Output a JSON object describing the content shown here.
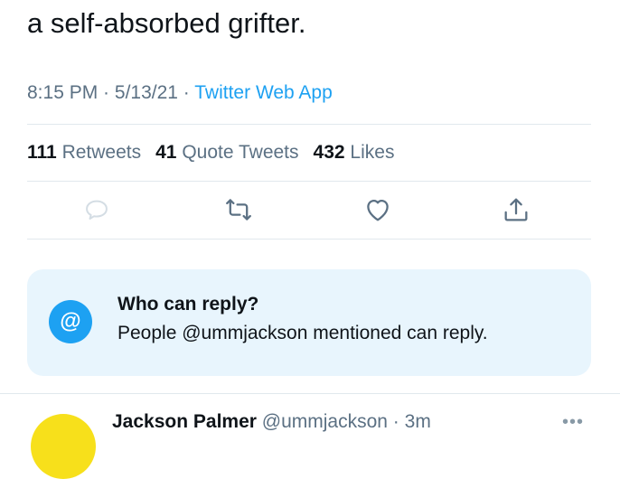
{
  "tweet": {
    "text": "a self-absorbed grifter.",
    "time": "8:15 PM",
    "separator": " · ",
    "date": "5/13/21",
    "source": "Twitter Web App"
  },
  "stats": {
    "retweets_count": "111",
    "retweets_label": "Retweets",
    "quotes_count": "41",
    "quotes_label": "Quote Tweets",
    "likes_count": "432",
    "likes_label": "Likes"
  },
  "actions": [
    {
      "name": "reply",
      "icon": "reply-icon"
    },
    {
      "name": "retweet",
      "icon": "retweet-icon"
    },
    {
      "name": "like",
      "icon": "heart-icon"
    },
    {
      "name": "share",
      "icon": "share-icon"
    }
  ],
  "reply_restriction": {
    "badge": "@",
    "title": "Who can reply?",
    "description": "People @ummjackson mentioned can reply."
  },
  "next_tweet": {
    "name": "Jackson Palmer",
    "handle": "@ummjackson",
    "separator": " · ",
    "time": "3m",
    "more": "•••"
  },
  "colors": {
    "text": "#0f1419",
    "secondary": "#5b7083",
    "accent": "#1da1f2",
    "card_bg": "#e8f5fd",
    "divider": "#e1e8ed",
    "avatar": "#f7e01b"
  }
}
